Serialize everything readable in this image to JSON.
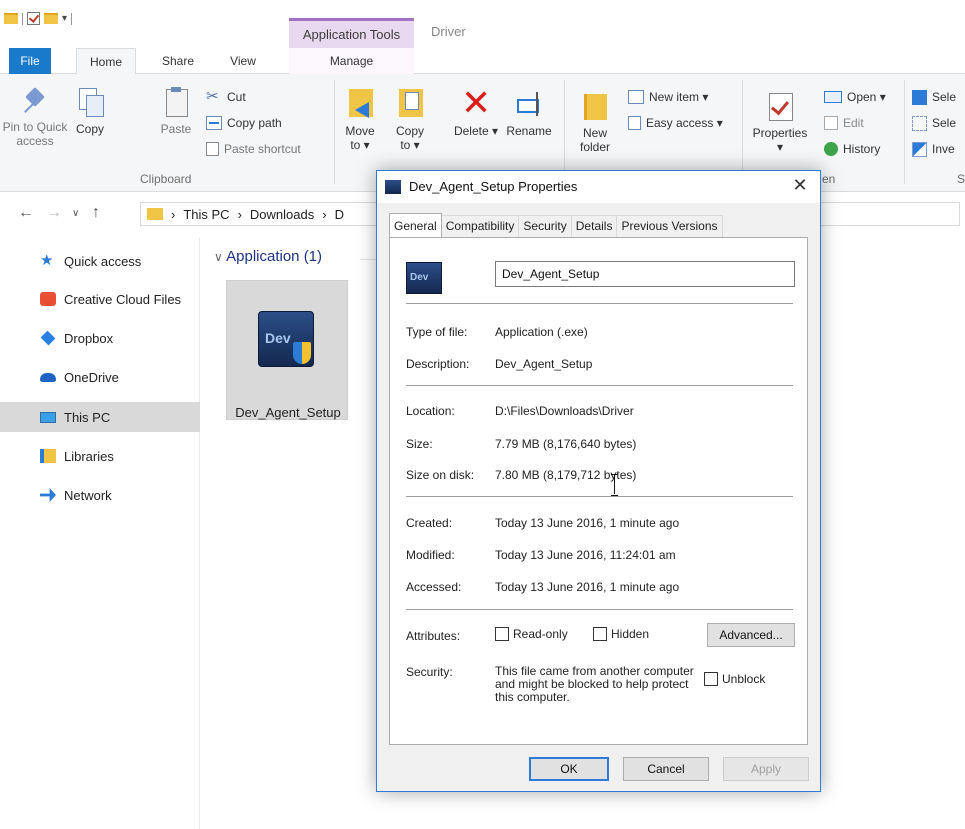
{
  "explorer": {
    "ribbon_context": "Application Tools",
    "title_path": "Driver",
    "tabs": {
      "file": "File",
      "home": "Home",
      "share": "Share",
      "view": "View",
      "manage": "Manage"
    },
    "clipboard": {
      "pin": "Pin to Quick access",
      "copy": "Copy",
      "paste": "Paste",
      "cut": "Cut",
      "copy_path": "Copy path",
      "paste_shortcut": "Paste shortcut",
      "group_label": "Clipboard"
    },
    "organize": {
      "move_to": "Move to ▾",
      "copy_to": "Copy to ▾",
      "delete": "Delete ▾",
      "rename": "Rename"
    },
    "new": {
      "new_folder": "New folder",
      "new_item": "New item ▾",
      "easy_access": "Easy access ▾"
    },
    "open": {
      "properties": "Properties ▾",
      "open": "Open ▾",
      "edit": "Edit",
      "history": "History",
      "group_label_partial": "en"
    },
    "select": {
      "select_all": "Sele",
      "select_none": "Sele",
      "invert": "Inve",
      "group_label_partial": "S"
    },
    "address": {
      "segments": [
        "This PC",
        "Downloads",
        "D"
      ]
    },
    "sidebar": {
      "items": [
        {
          "label": "Quick access",
          "icon": "star-icon"
        },
        {
          "label": "Creative Cloud Files",
          "icon": "creative-cloud-icon"
        },
        {
          "label": "Dropbox",
          "icon": "dropbox-icon"
        },
        {
          "label": "OneDrive",
          "icon": "onedrive-icon"
        },
        {
          "label": "This PC",
          "icon": "pc-icon",
          "selected": true
        },
        {
          "label": "Libraries",
          "icon": "libraries-icon"
        },
        {
          "label": "Network",
          "icon": "network-icon"
        }
      ]
    },
    "content": {
      "group_header": "Application (1)",
      "file_name": "Dev_Agent_Setup",
      "icon_text": "Dev"
    }
  },
  "dialog": {
    "title": "Dev_Agent_Setup Properties",
    "close_glyph": "✕",
    "tabs": [
      "General",
      "Compatibility",
      "Security",
      "Details",
      "Previous Versions"
    ],
    "active_tab": "General",
    "icon_text": "Dev",
    "name_value": "Dev_Agent_Setup",
    "type_label": "Type of file:",
    "type_value": "Application (.exe)",
    "description_label": "Description:",
    "description_value": "Dev_Agent_Setup",
    "location_label": "Location:",
    "location_value": "D:\\Files\\Downloads\\Driver",
    "size_label": "Size:",
    "size_value": "7.79 MB (8,176,640 bytes)",
    "size_on_disk_label": "Size on disk:",
    "size_on_disk_value": "7.80 MB (8,179,712 bytes)",
    "created_label": "Created:",
    "created_value": "Today 13 June 2016, 1 minute ago",
    "modified_label": "Modified:",
    "modified_value": "Today 13 June 2016, 11:24:01 am",
    "accessed_label": "Accessed:",
    "accessed_value": "Today 13 June 2016, 1 minute ago",
    "attributes_label": "Attributes:",
    "readonly_label": "Read-only",
    "hidden_label": "Hidden",
    "advanced_label": "Advanced...",
    "security_label": "Security:",
    "security_text": "This file came from another computer and might be blocked to help protect this computer.",
    "unblock_label": "Unblock",
    "ok_label": "OK",
    "cancel_label": "Cancel",
    "apply_label": "Apply"
  },
  "colors": {
    "accent": "#1979ca",
    "context_tab": "#a371c2",
    "selected_nav": "#d9d9d9",
    "dialog_border": "#2c7bd6"
  }
}
